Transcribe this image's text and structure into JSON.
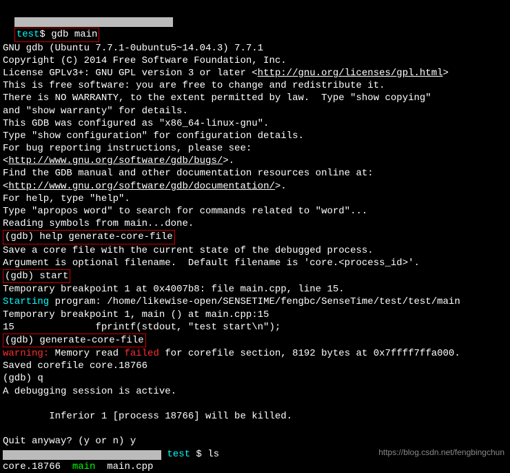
{
  "prompt1_dir": "test",
  "prompt1_cmd": "$ gdb main",
  "gdb_banner": [
    "GNU gdb (Ubuntu 7.7.1-0ubuntu5~14.04.3) 7.7.1",
    "Copyright (C) 2014 Free Software Foundation, Inc."
  ],
  "license_pre": "License GPLv3+: GNU GPL version 3 or later <",
  "license_url": "http://gnu.org/licenses/gpl.html",
  "license_post": ">",
  "free_lines": [
    "This is free software: you are free to change and redistribute it.",
    "There is NO WARRANTY, to the extent permitted by law.  Type \"show copying\"",
    "and \"show warranty\" for details.",
    "This GDB was configured as \"x86_64-linux-gnu\".",
    "Type \"show configuration\" for configuration details.",
    "For bug reporting instructions, please see:"
  ],
  "bugs_pre": "<",
  "bugs_url": "http://www.gnu.org/software/gdb/bugs/",
  "bugs_post": ">.",
  "find_line": "Find the GDB manual and other documentation resources online at:",
  "docs_pre": "<",
  "docs_url": "http://www.gnu.org/software/gdb/documentation/",
  "docs_post": ">.",
  "help_lines": [
    "For help, type \"help\".",
    "Type \"apropos word\" to search for commands related to \"word\"...",
    "Reading symbols from main...done."
  ],
  "box_help_gcf": "(gdb) help generate-core-file",
  "gcf_desc": [
    "Save a core file with the current state of the debugged process.",
    "Argument is optional filename.  Default filename is 'core.<process_id>'."
  ],
  "box_start": "(gdb) start",
  "tmp_bp": "Temporary breakpoint 1 at 0x4007b8: file main.cpp, line 15.",
  "starting_label": "Starting",
  "starting_rest": " program: /home/likewise-open/SENSETIME/fengbc/SenseTime/test/test/main",
  "blank": "",
  "bp_hit": "Temporary breakpoint 1, main () at main.cpp:15",
  "src_line": "15              fprintf(stdout, \"test start\\n\");",
  "box_gcf": "(gdb) generate-core-file",
  "warn_label": "warning:",
  "warn_mid": " Memory read ",
  "warn_failed": "failed",
  "warn_rest": " for corefile section, 8192 bytes at 0x7ffff7ffa000.",
  "saved": "Saved corefile core.18766",
  "quit_cmd": "(gdb) q",
  "active": "A debugging session is active.",
  "inferior": "        Inferior 1 [process 18766] will be killed.",
  "quit_q": "Quit anyway? (y or n) y",
  "prompt2_dir": " test",
  "prompt2_cmd": " $ ls",
  "ls_core": "core.18766  ",
  "ls_main": "main",
  "ls_cpp": "  main.cpp",
  "watermark": "https://blog.csdn.net/fengbingchun",
  "watermark_cn": ""
}
